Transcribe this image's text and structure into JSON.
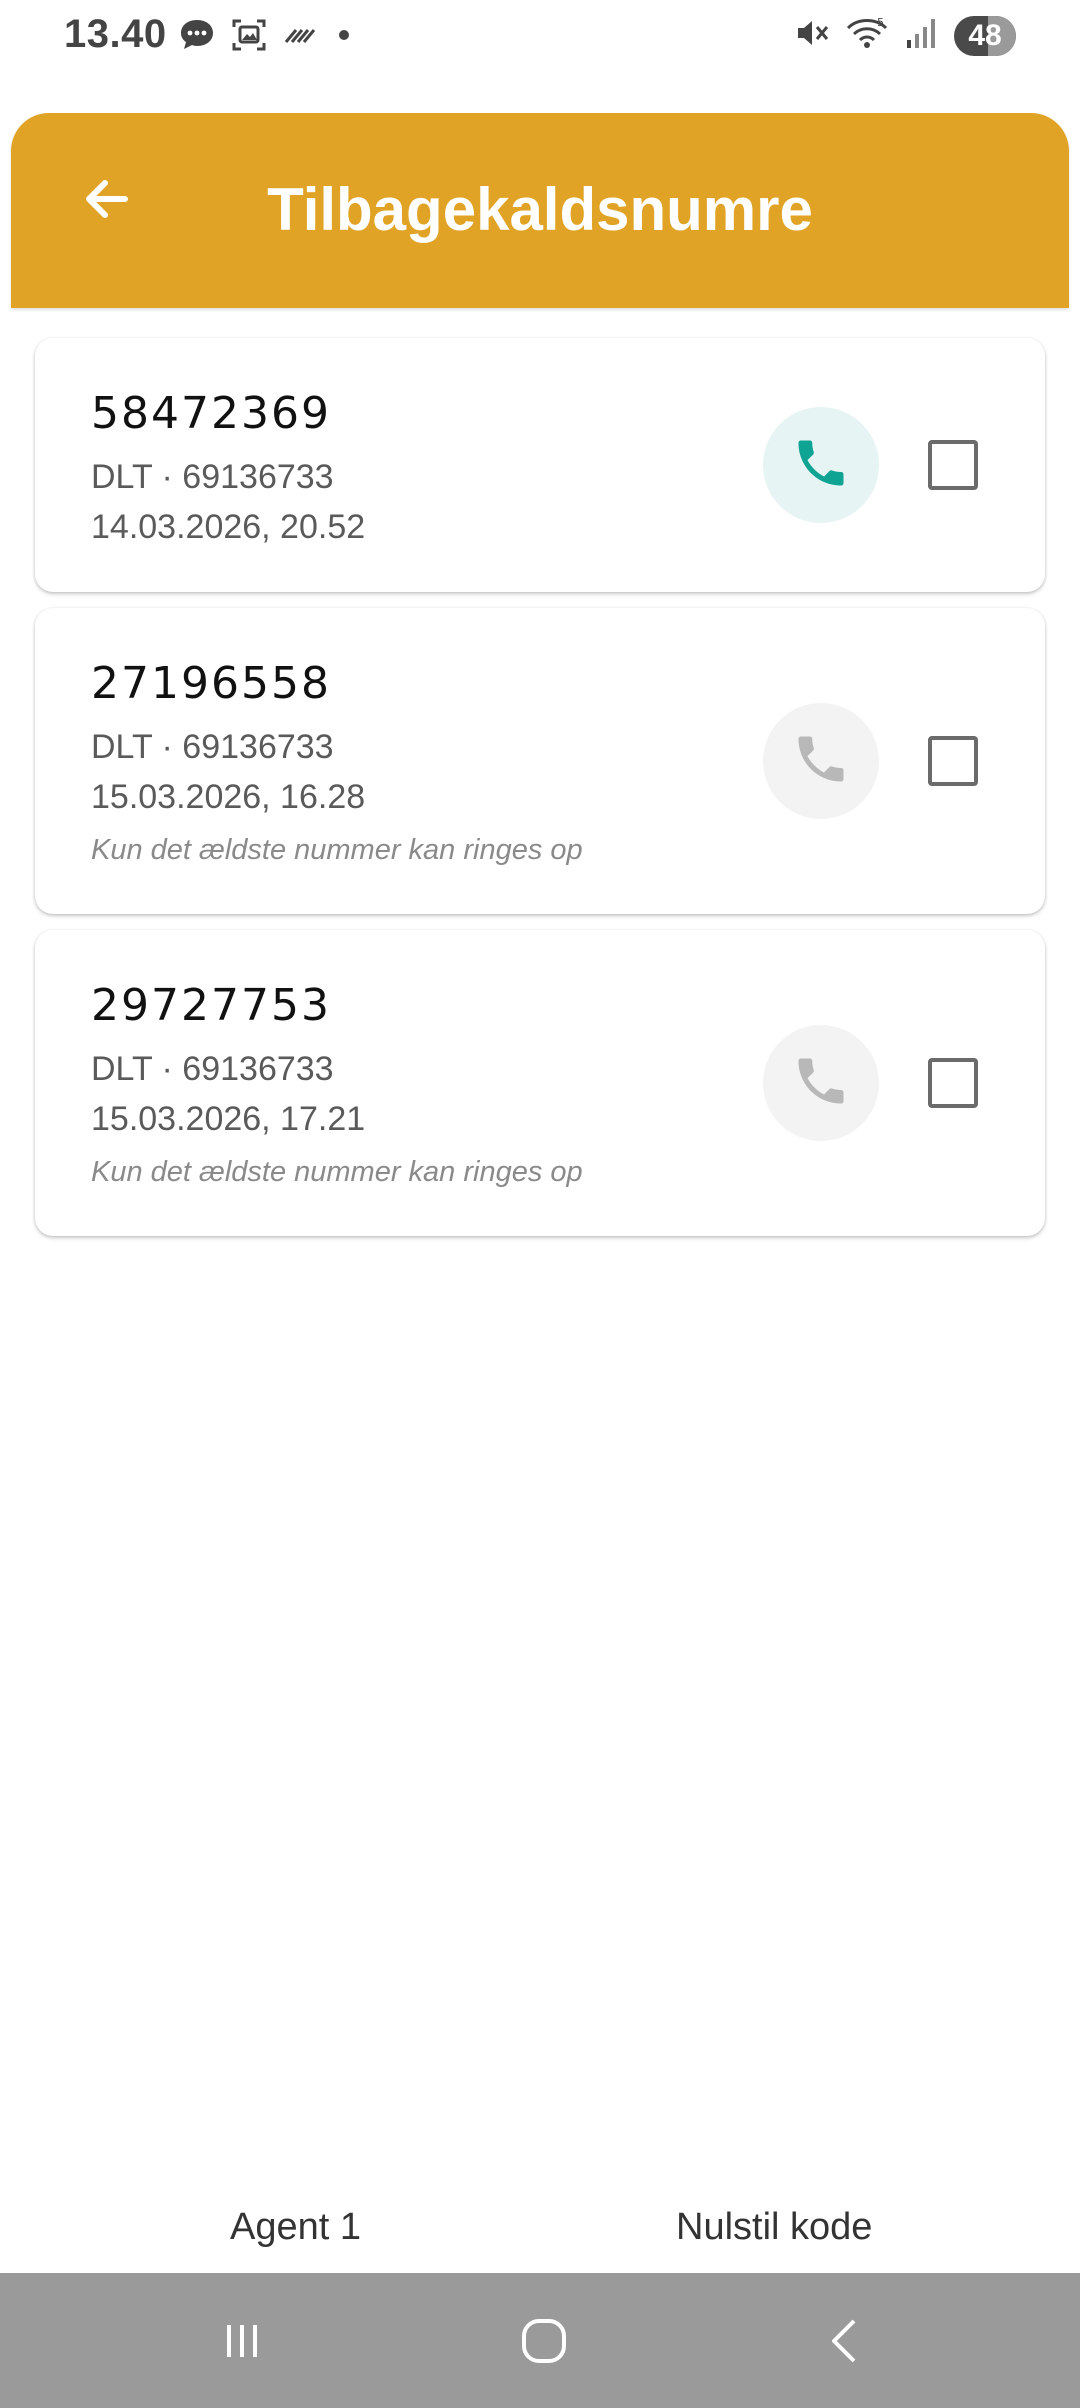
{
  "status_bar": {
    "time": "13.40",
    "battery_level": "48",
    "left_icons": [
      "chat-bubble-icon",
      "screenshot-icon",
      "nfc-icon",
      "dot-icon"
    ],
    "right_icons": [
      "mute-icon",
      "wifi-icon",
      "signal-icon",
      "battery-icon"
    ]
  },
  "header": {
    "title": "Tilbagekaldsnumre",
    "background_color": "#E0A326",
    "back_icon": "arrow-left-icon"
  },
  "callbacks": [
    {
      "number": "58472369",
      "subtitle": "DLT · 69136733",
      "datetime": "14.03.2026, 20.52",
      "note": "",
      "call_enabled": true,
      "checked": false
    },
    {
      "number": "27196558",
      "subtitle": "DLT · 69136733",
      "datetime": "15.03.2026, 16.28",
      "note": "Kun det ældste nummer kan ringes op",
      "call_enabled": false,
      "checked": false
    },
    {
      "number": "29727753",
      "subtitle": "DLT · 69136733",
      "datetime": "15.03.2026, 17.21",
      "note": "Kun det ældste nummer kan ringes op",
      "call_enabled": false,
      "checked": false
    }
  ],
  "colors": {
    "call_active": "#0FA394",
    "call_active_bg": "#E6F4F3",
    "call_disabled": "#B8B8B8",
    "call_disabled_bg": "#F3F3F3"
  },
  "footer": {
    "agent_label": "Agent 1",
    "reset_label": "Nulstil kode"
  },
  "nav_bar": {
    "icons": [
      "recent-apps-icon",
      "home-icon",
      "back-icon"
    ]
  }
}
